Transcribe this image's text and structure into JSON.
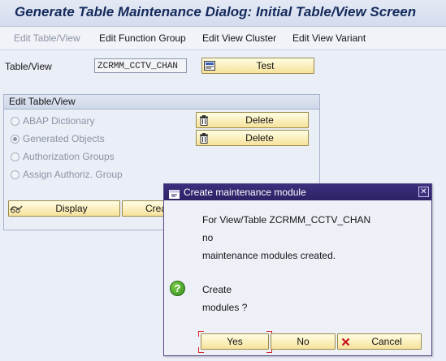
{
  "title": "Generate Table Maintenance Dialog: Initial Table/View Screen",
  "menu": [
    {
      "label": "Edit Table/View",
      "enabled": false
    },
    {
      "label": "Edit Function Group",
      "enabled": true
    },
    {
      "label": "Edit View Cluster",
      "enabled": true
    },
    {
      "label": "Edit View Variant",
      "enabled": true
    }
  ],
  "field": {
    "label": "Table/View",
    "value": "ZCRMM_CCTV_CHAN"
  },
  "test_button": "Test",
  "group": {
    "title": "Edit Table/View",
    "options": [
      {
        "label": "ABAP Dictionary",
        "checked": false
      },
      {
        "label": "Generated Objects",
        "checked": true
      },
      {
        "label": "Authorization Groups",
        "checked": false
      },
      {
        "label": "Assign Authoriz. Group",
        "checked": false
      }
    ],
    "delete_1": "Delete",
    "delete_2": "Delete",
    "display_button": "Display",
    "create_button_partial": "Crea"
  },
  "dialog": {
    "title": "Create maintenance module",
    "line1": "For View/Table ZCRMM_CCTV_CHAN",
    "line2": "no",
    "line3": "maintenance modules created.",
    "question1": "Create",
    "question2": "modules ?",
    "yes": "Yes",
    "no": "No",
    "cancel": "Cancel",
    "close_glyph": "✕",
    "question_glyph": "?"
  },
  "colors": {
    "title_text": "#142a5c",
    "dialog_titlebar": "#2c2266",
    "button_fill": "#f6e29b",
    "disabled_text": "#8c93a3",
    "focus_corners": "#d6272d"
  },
  "icons": [
    "test-icon",
    "trash-icon",
    "display-icon",
    "dialog-window-icon",
    "question-icon",
    "cancel-x-icon"
  ]
}
